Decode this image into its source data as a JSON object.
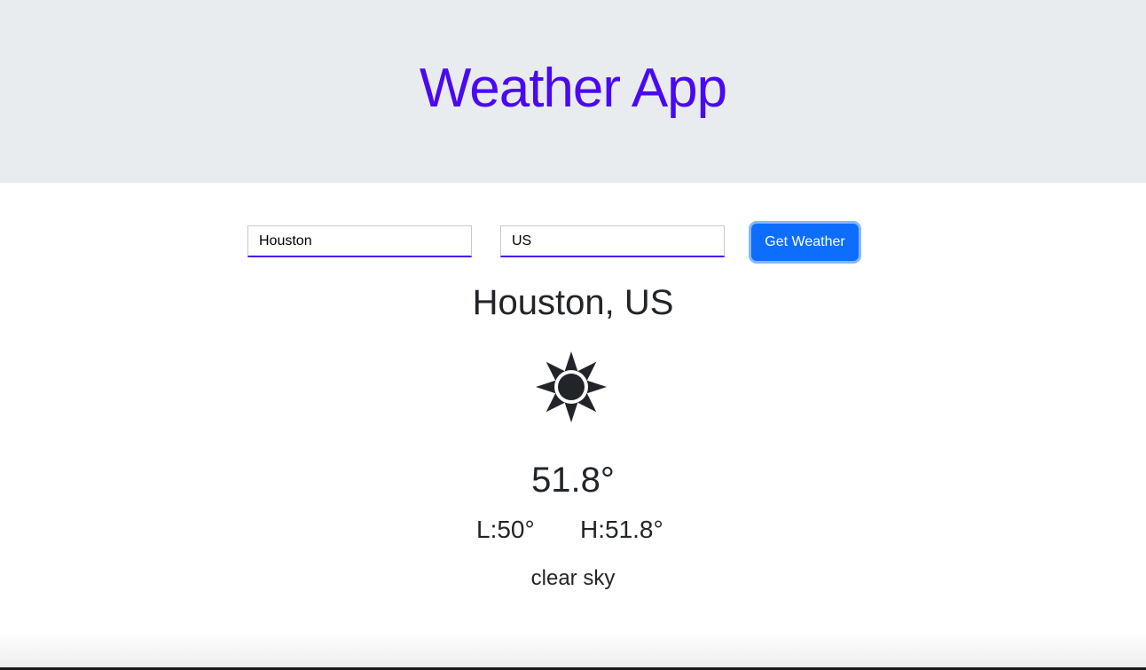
{
  "header": {
    "title": "Weather App"
  },
  "search": {
    "city_value": "Houston",
    "country_value": "US",
    "submit_label": "Get Weather"
  },
  "weather": {
    "location": "Houston, US",
    "icon": "sun-icon",
    "temperature": "51.8°",
    "low": "L:50°",
    "high": "H:51.8°",
    "description": "clear sky"
  },
  "colors": {
    "title": "#4a09f2",
    "field_underline": "#4a09f2",
    "button": "#0d6efd",
    "button_focus_ring": "#86b7fe",
    "text": "#212529",
    "header_bg": "#e9ecef"
  }
}
